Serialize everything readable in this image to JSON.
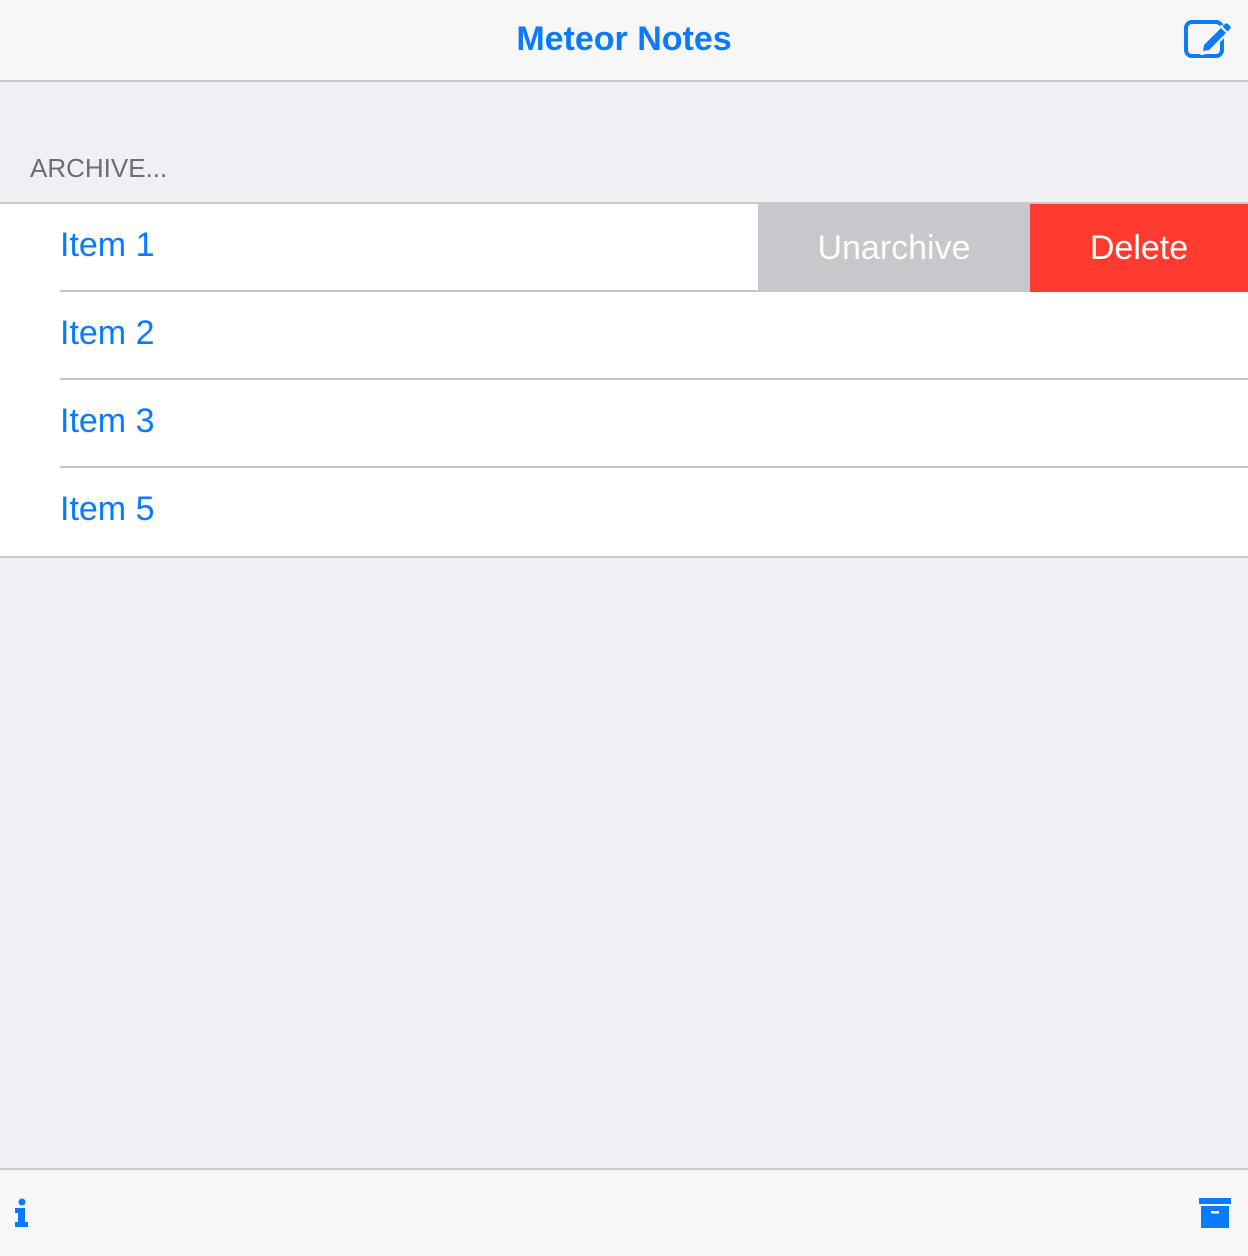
{
  "navbar": {
    "title": "Meteor Notes",
    "compose_icon": "compose-icon"
  },
  "section": {
    "header": "ARCHIVE..."
  },
  "items": [
    {
      "label": "Item 1"
    },
    {
      "label": "Item 2"
    },
    {
      "label": "Item 3"
    },
    {
      "label": "Item 5"
    }
  ],
  "swipe_actions": {
    "unarchive_label": "Unarchive",
    "delete_label": "Delete"
  },
  "toolbar": {
    "info_icon": "info-icon",
    "archive_icon": "archive-icon"
  },
  "colors": {
    "accent": "#0a7aff",
    "delete": "#ff3b30",
    "unarchive": "#c7c7cc",
    "background": "#efeff4"
  }
}
